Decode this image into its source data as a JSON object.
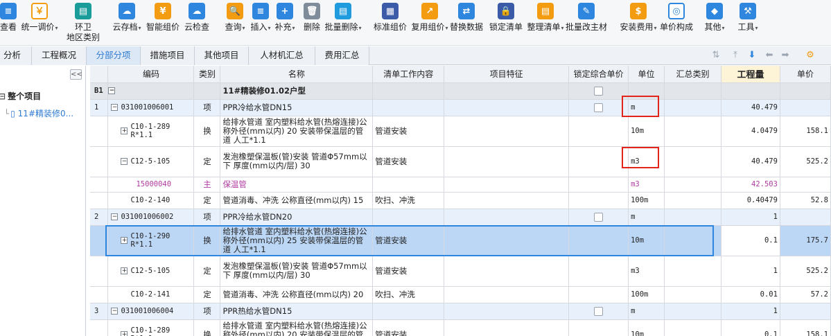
{
  "toolbar": {
    "items": [
      {
        "label": "查看",
        "icon": "view-icon"
      },
      {
        "label": "统一调价",
        "icon": "unify-price-icon",
        "dropdown": true
      },
      {
        "label": "环卫",
        "label2": "地区类别",
        "icon": "region-category-icon"
      },
      {
        "label": "云存档",
        "icon": "cloud-archive-icon",
        "dropdown": true
      },
      {
        "label": "智能组价",
        "icon": "smart-pricing-icon"
      },
      {
        "label": "云检查",
        "icon": "cloud-check-icon"
      },
      {
        "label": "查询",
        "icon": "query-icon",
        "dropdown": true
      },
      {
        "label": "插入",
        "icon": "insert-icon",
        "dropdown": true
      },
      {
        "label": "补充",
        "icon": "supplement-icon",
        "dropdown": true
      },
      {
        "label": "删除",
        "icon": "delete-icon"
      },
      {
        "label": "批量删除",
        "icon": "batch-delete-icon",
        "dropdown": true
      },
      {
        "label": "标准组价",
        "icon": "standard-pricing-icon"
      },
      {
        "label": "复用组价",
        "icon": "reuse-pricing-icon",
        "dropdown": true
      },
      {
        "label": "替换数据",
        "icon": "replace-data-icon"
      },
      {
        "label": "锁定清单",
        "icon": "lock-list-icon"
      },
      {
        "label": "整理清单",
        "icon": "organize-list-icon",
        "dropdown": true
      },
      {
        "label": "批量改主材",
        "icon": "batch-edit-material-icon"
      },
      {
        "label": "安装费用",
        "icon": "install-fee-icon",
        "dropdown": true
      },
      {
        "label": "单价构成",
        "icon": "unit-price-composition-icon"
      },
      {
        "label": "其他",
        "icon": "other-icon",
        "dropdown": true
      },
      {
        "label": "工具",
        "icon": "tools-icon",
        "dropdown": true
      }
    ]
  },
  "tabs": [
    "分析",
    "工程概况",
    "分部分项",
    "措施项目",
    "其他项目",
    "人材机汇总",
    "费用汇总"
  ],
  "active_tab": "分部分项",
  "left_panel": {
    "collapse_label": "<<",
    "root": "整个项目",
    "child": "11#精装修0..."
  },
  "columns": [
    "",
    "编码",
    "类别",
    "名称",
    "清单工作内容",
    "项目特征",
    "锁定综合单价",
    "单位",
    "汇总类别",
    "工程量",
    "单价"
  ],
  "rows": [
    {
      "kind": "group",
      "rownum": "B1",
      "code": "",
      "cat": "",
      "name": "11#精装修01.02户型",
      "work": "",
      "feature": "",
      "lock": true,
      "unit": "",
      "sumcat": "",
      "qty": "",
      "price": ""
    },
    {
      "kind": "item",
      "rownum": "1",
      "code": "031001006001",
      "cat": "项",
      "name": "PPR冷给水管DN15",
      "work": "",
      "feature": "",
      "lock": true,
      "unit": "m",
      "sumcat": "",
      "qty": "40.479",
      "price": ""
    },
    {
      "kind": "sub",
      "rownum": "",
      "code": "C10-1-289\nR*1.1",
      "cat": "换",
      "name": "给排水管道 室内塑料给水管(热熔连接)公称外径(mm以内) 20  安装带保温层的管道 人工*1.1",
      "work": "管道安装",
      "feature": "",
      "lock": false,
      "unit": "10m",
      "sumcat": "",
      "qty": "4.0479",
      "price": "158.1"
    },
    {
      "kind": "sub",
      "rownum": "",
      "code": "C12-5-105",
      "cat": "定",
      "name": "发泡橡塑保温板(管)安装 管道Φ57mm以下 厚度(mm以内/层) 30",
      "work": "管道安装",
      "feature": "",
      "lock": false,
      "unit": "m3",
      "sumcat": "",
      "qty": "40.479",
      "price": "525.2"
    },
    {
      "kind": "main",
      "rownum": "",
      "code": "15000040",
      "cat": "主",
      "name": "保温管",
      "work": "",
      "feature": "",
      "lock": false,
      "unit": "m3",
      "sumcat": "",
      "qty": "42.503",
      "price": ""
    },
    {
      "kind": "sub",
      "rownum": "",
      "code": "C10-2-140",
      "cat": "定",
      "name": "管道消毒、冲洗 公称直径(mm以内) 15",
      "work": "吹扫、冲洗",
      "feature": "",
      "lock": false,
      "unit": "100m",
      "sumcat": "",
      "qty": "0.40479",
      "price": "52.8"
    },
    {
      "kind": "item",
      "rownum": "2",
      "code": "031001006002",
      "cat": "项",
      "name": "PPR冷给水管DN20",
      "work": "",
      "feature": "",
      "lock": true,
      "unit": "m",
      "sumcat": "",
      "qty": "1",
      "price": ""
    },
    {
      "kind": "sel",
      "rownum": "",
      "code": "C10-1-290\nR*1.1",
      "cat": "换",
      "name": "给排水管道 室内塑料给水管(热熔连接)公称外径(mm以内) 25  安装带保温层的管道 人工*1.1",
      "work": "管道安装",
      "feature": "",
      "lock": false,
      "unit": "10m",
      "sumcat": "",
      "qty": "0.1",
      "price": "175.7"
    },
    {
      "kind": "sub",
      "rownum": "",
      "code": "C12-5-105",
      "cat": "定",
      "name": "发泡橡塑保温板(管)安装 管道Φ57mm以下 厚度(mm以内/层) 30",
      "work": "管道安装",
      "feature": "",
      "lock": false,
      "unit": "m3",
      "sumcat": "",
      "qty": "1",
      "price": "525.2"
    },
    {
      "kind": "sub",
      "rownum": "",
      "code": "C10-2-141",
      "cat": "定",
      "name": "管道消毒、冲洗 公称直径(mm以内) 20",
      "work": "吹扫、冲洗",
      "feature": "",
      "lock": false,
      "unit": "100m",
      "sumcat": "",
      "qty": "0.01",
      "price": "57.2"
    },
    {
      "kind": "item",
      "rownum": "3",
      "code": "031001006004",
      "cat": "项",
      "name": "PPR热给水管DN15",
      "work": "",
      "feature": "",
      "lock": true,
      "unit": "m",
      "sumcat": "",
      "qty": "1",
      "price": ""
    },
    {
      "kind": "sub",
      "rownum": "",
      "code": "C10-1-289\nR*1.1",
      "cat": "换",
      "name": "给排水管道 室内塑料给水管(热熔连接)公称外径(mm以内) 20  安装带保温层的管道 人工*1.1",
      "work": "管道安装",
      "feature": "",
      "lock": false,
      "unit": "10m",
      "sumcat": "",
      "qty": "0.1",
      "price": "158.1"
    }
  ],
  "colors": {
    "accent": "#2e86de",
    "highlight_box": "#e3241b",
    "main_material": "#b03aa0"
  }
}
